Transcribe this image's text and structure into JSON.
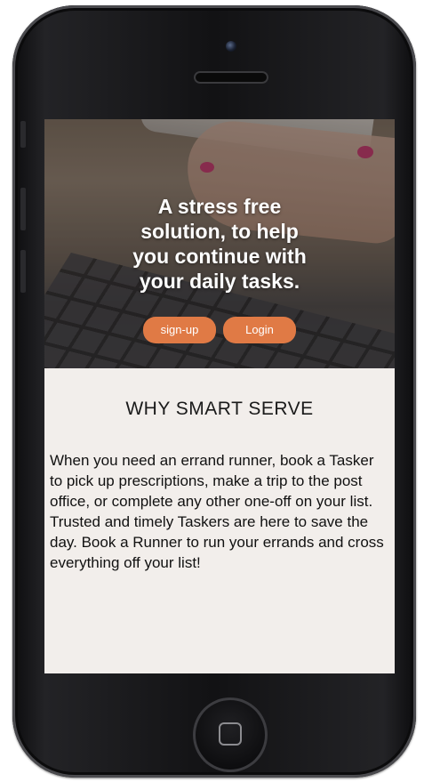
{
  "hero": {
    "title": "A stress free\nsolution, to help\nyou continue with\nyour daily tasks.",
    "signup_label": "sign-up",
    "login_label": "Login"
  },
  "section": {
    "title": "WHY SMART SERVE",
    "body": "When you need an errand runner, book a Tasker to pick up prescriptions, make a trip to the post office, or complete any other one-off on your list. Trusted and timely Taskers are here to save the day. Book a Runner to run your errands and cross everything off your list!"
  },
  "colors": {
    "accent": "#e07a45",
    "page_background": "#f2eeeb",
    "device_frame": "#121214"
  }
}
